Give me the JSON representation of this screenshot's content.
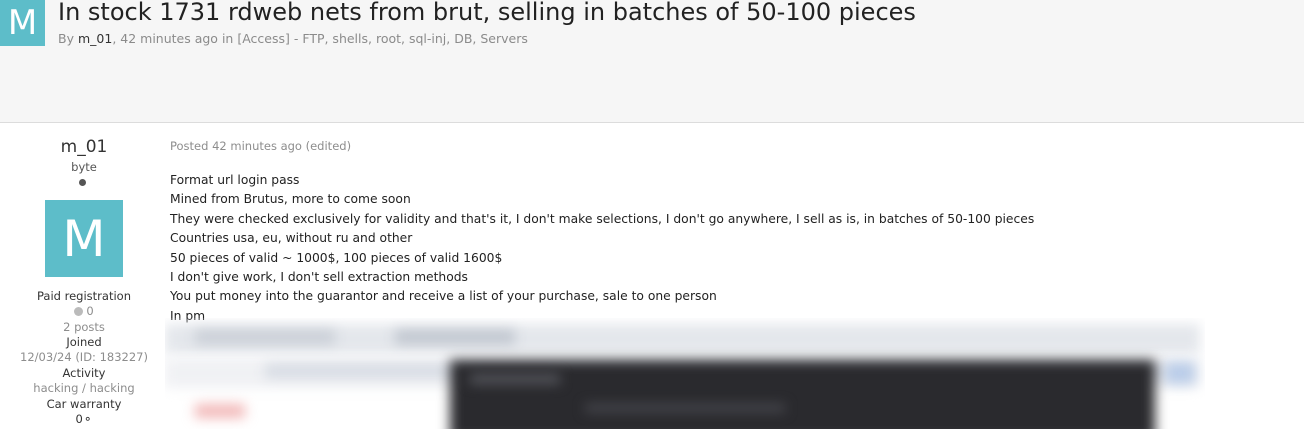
{
  "topic": {
    "avatar_letter": "M",
    "title": "In stock 1731 rdweb nets from brut, selling in batches of 50-100 pieces",
    "by_label": "By",
    "author": "m_01",
    "time_ago": "42 minutes ago",
    "in_label": "in",
    "forum": "[Access] - FTP, shells, root, sql-inj, DB, Servers"
  },
  "author_panel": {
    "username": "m_01",
    "rank": "byte",
    "avatar_letter": "M",
    "group": "Paid registration",
    "reputation": "0",
    "posts": "2 posts",
    "joined_label": "Joined",
    "joined_value": "12/03/24 (ID: 183227)",
    "activity_label": "Activity",
    "activity_value": "hacking / hacking",
    "warranty_label": "Car warranty",
    "warranty_value": "0"
  },
  "post": {
    "posted": "Posted 42 minutes ago (edited)",
    "lines": [
      "Format url login pass",
      "Mined from Brutus, more to come soon",
      "They were checked exclusively for validity and that's it, I don't make selections, I don't go anywhere, I sell as is, in batches of 50-100 pieces",
      "Countries usa, eu, without ru and other",
      "50 pieces of valid ~ 1000$, 100 pieces of valid 1600$",
      "I don't give work, I don't sell extraction methods",
      "You put money into the guarantor and receive a list of your purchase, sale to one person",
      "In pm"
    ]
  },
  "colors": {
    "avatar_bg": "#5dbdc9",
    "header_bg": "#f6f6f6"
  }
}
